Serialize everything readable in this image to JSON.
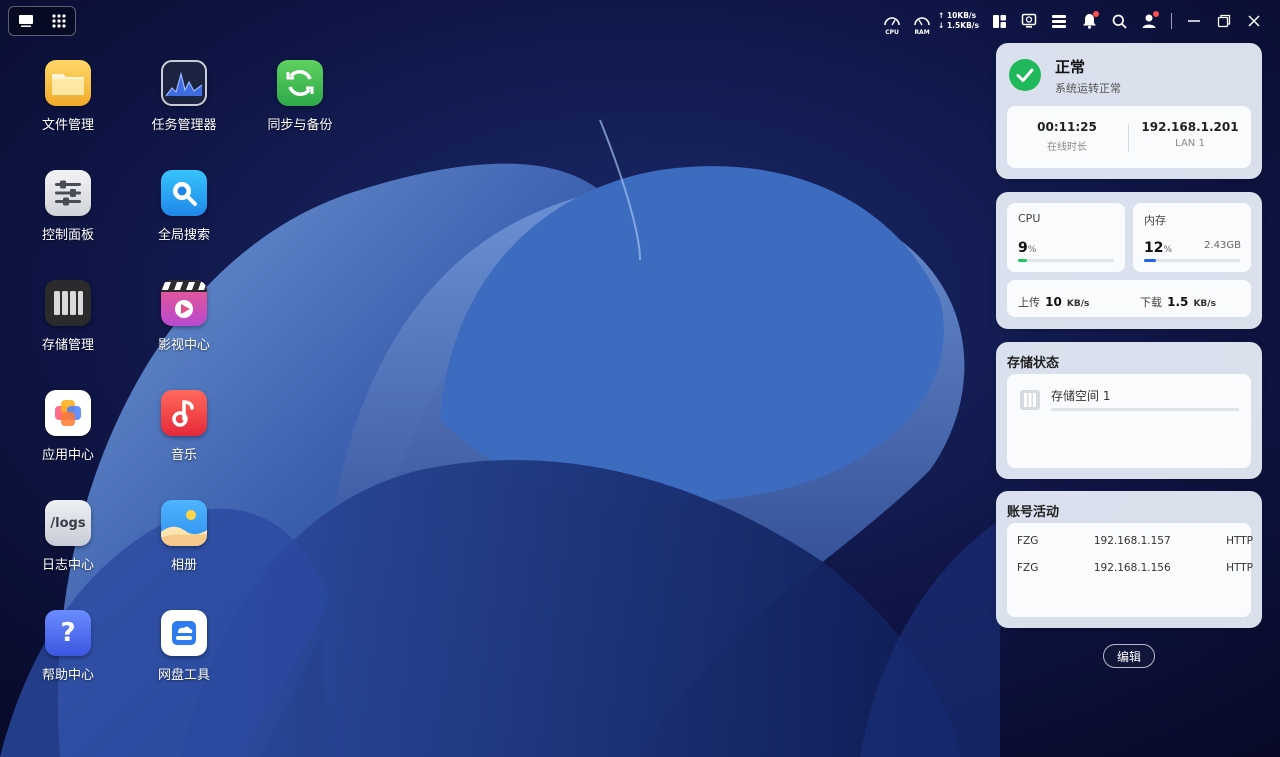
{
  "taskbar": {
    "show_desktop_icon": "desktop-icon",
    "app_launcher_icon": "grid-icon"
  },
  "tray": {
    "cpu_label": "CPU",
    "ram_label": "RAM",
    "upload_speed": "10KB/s",
    "download_speed": "1.5KB/s",
    "icons": [
      "widget-panel-icon",
      "monitor-icon",
      "task-list-icon",
      "bell-icon",
      "search-icon",
      "user-icon",
      "minimize-icon",
      "restore-icon",
      "close-icon"
    ]
  },
  "apps": [
    {
      "label": "文件管理",
      "icon": "folder-icon"
    },
    {
      "label": "任务管理器",
      "icon": "task-manager-icon"
    },
    {
      "label": "同步与备份",
      "icon": "sync-icon"
    },
    {
      "label": "控制面板",
      "icon": "control-panel-icon"
    },
    {
      "label": "全局搜索",
      "icon": "search-app-icon"
    },
    {
      "label": "存储管理",
      "icon": "storage-icon"
    },
    {
      "label": "影视中心",
      "icon": "video-icon"
    },
    {
      "label": "应用中心",
      "icon": "app-center-icon"
    },
    {
      "label": "音乐",
      "icon": "music-icon"
    },
    {
      "label": "日志中心",
      "icon": "logs-icon",
      "icon_text": "/logs"
    },
    {
      "label": "相册",
      "icon": "photos-icon"
    },
    {
      "label": "帮助中心",
      "icon": "help-icon",
      "icon_text": "?"
    },
    {
      "label": "网盘工具",
      "icon": "cloud-drive-icon"
    }
  ],
  "status_widget": {
    "title": "正常",
    "subtitle": "系统运转正常",
    "uptime_value": "00:11:25",
    "uptime_label": "在线时长",
    "ip_value": "192.168.1.201",
    "ip_label": "LAN 1"
  },
  "resource_widget": {
    "cpu_label": "CPU",
    "cpu_value": "9",
    "cpu_unit": "%",
    "cpu_percent": 9,
    "mem_label": "内存",
    "mem_value": "12",
    "mem_unit": "%",
    "mem_percent": 12,
    "mem_used": "2.43GB",
    "upload_label": "上传",
    "upload_value": "10",
    "upload_unit": "KB/s",
    "download_label": "下载",
    "download_value": "1.5",
    "download_unit": "KB/s",
    "colors": {
      "cpu_bar": "#22c55e",
      "mem_bar": "#2563eb"
    }
  },
  "storage_widget": {
    "title": "存储状态",
    "pool_name": "存储空间 1"
  },
  "activity_widget": {
    "title": "账号活动",
    "rows": [
      {
        "user": "FZG",
        "ip": "192.168.1.157",
        "protocol": "HTTP"
      },
      {
        "user": "FZG",
        "ip": "192.168.1.156",
        "protocol": "HTTP"
      }
    ]
  },
  "edit_label": "编辑"
}
